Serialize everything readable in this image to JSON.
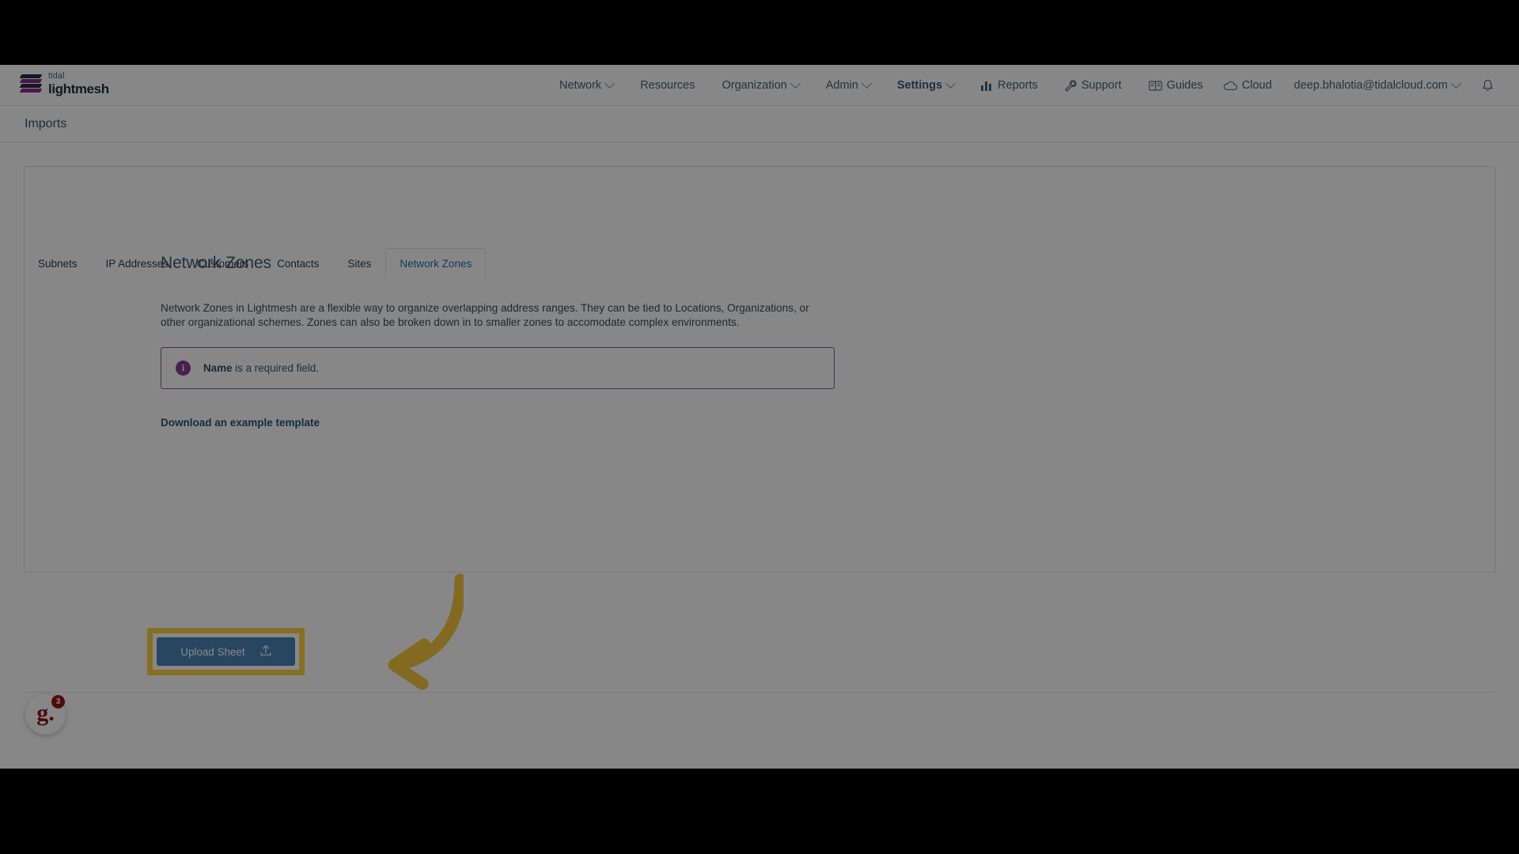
{
  "brand": {
    "top": "tidal",
    "bottom": "lightmesh"
  },
  "nav": {
    "items": [
      {
        "label": "Network",
        "has_caret": true,
        "active": false,
        "icon": ""
      },
      {
        "label": "Resources",
        "has_caret": false,
        "active": false,
        "icon": ""
      },
      {
        "label": "Organization",
        "has_caret": true,
        "active": false,
        "icon": ""
      },
      {
        "label": "Admin",
        "has_caret": true,
        "active": false,
        "icon": ""
      },
      {
        "label": "Settings",
        "has_caret": true,
        "active": true,
        "icon": ""
      },
      {
        "label": "Reports",
        "has_caret": false,
        "active": false,
        "icon": "chart-bar-icon"
      },
      {
        "label": "Support",
        "has_caret": false,
        "active": false,
        "icon": "wrench-icon"
      },
      {
        "label": "Guides",
        "has_caret": false,
        "active": false,
        "icon": "book-icon"
      }
    ],
    "right": {
      "cloud_label": "Cloud",
      "cloud_icon": "cloud-icon",
      "account_email": "deep.bhalotia@tidalcloud.com",
      "account_caret": true,
      "bell_icon": "bell-icon"
    }
  },
  "page": {
    "title": "Imports"
  },
  "tabs": [
    {
      "label": "Subnets",
      "active": false
    },
    {
      "label": "IP Addresses",
      "active": false
    },
    {
      "label": "Customers",
      "active": false
    },
    {
      "label": "Contacts",
      "active": false
    },
    {
      "label": "Sites",
      "active": false
    },
    {
      "label": "Network Zones",
      "active": true
    }
  ],
  "main": {
    "heading": "Network Zones",
    "description": "Network Zones in Lightmesh are a flexible way to organize overlapping address ranges. They can be tied to Locations, Organizations, or other organizational schemes. Zones can also be broken down in to smaller zones to accomodate complex environments.",
    "alert": {
      "icon": "info-icon",
      "icon_glyph": "i",
      "strong": "Name",
      "rest": " is a required field.",
      "border_color": "#9b4d9b",
      "icon_color": "#8e3c8e"
    },
    "download_link": "Download an example template",
    "upload_button": {
      "label": "Upload Sheet",
      "icon": "upload-icon",
      "background": "#4a86b8",
      "highlight_color": "#ffd23f"
    }
  },
  "annotation": {
    "arrow_color": "#f5cb3f",
    "arrow_direction": "left"
  },
  "help_widget": {
    "glyph": "g.",
    "badge_count": "3",
    "badge_color": "#9a1313"
  }
}
